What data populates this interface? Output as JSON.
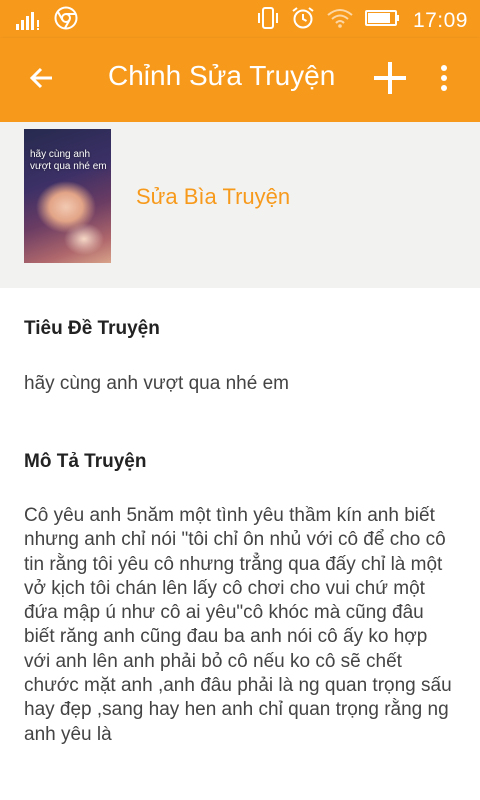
{
  "status_bar": {
    "time": "17:09",
    "icons": [
      "signal-icon",
      "chrome-icon",
      "vibrate-icon",
      "alarm-icon",
      "wifi-icon",
      "battery-icon"
    ]
  },
  "app_bar": {
    "title": "Chỉnh Sửa Truyện",
    "back_icon": "arrow-left-icon",
    "add_icon": "plus-icon",
    "more_icon": "more-vertical-icon"
  },
  "cover": {
    "thumbnail_text": "hãy cùng anh vượt qua nhé em",
    "edit_label": "Sửa Bìa Truyện"
  },
  "story": {
    "title_label": "Tiêu Đề Truyện",
    "title_value": "hãy cùng anh vượt qua nhé em",
    "description_label": "Mô Tả Truyện",
    "description_value": "Cô yêu anh 5năm một tình yêu thầm kín anh biết nhưng anh chỉ nói \"tôi chỉ ôn nhủ với cô để cho cô tin rằng tôi yêu cô nhưng trẳng qua đấy chỉ là một vở kịch tôi chán lên lấy cô chơi cho vui chứ một đứa mập ú như cô ai yêu\"cô khóc mà cũng đâu biết răng anh cũng đau ba anh nói cô ấy ko hợp với anh lên anh phải bỏ cô nếu ko cô sẽ chết chước mặt anh ,anh đâu phải là ng quan trọng sấu hay đẹp ,sang hay hen anh chỉ quan trọng rằng ng anh yêu là"
  },
  "colors": {
    "accent": "#f79a1c",
    "cover_bg": "#f2f2f0",
    "text_primary": "#222222",
    "text_secondary": "#444444"
  }
}
